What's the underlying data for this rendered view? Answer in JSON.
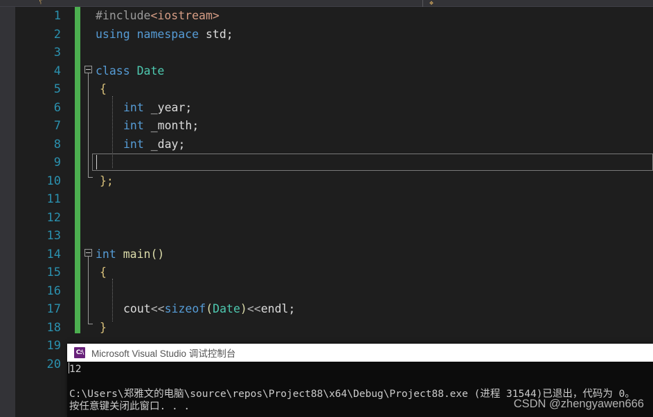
{
  "app": {
    "name": "Microsoft Visual Studio",
    "theme": "dark"
  },
  "toolbar": {
    "left_glyph": "⸮",
    "right_glyph": "❖"
  },
  "editor": {
    "language": "cpp",
    "line_numbers": [
      "1",
      "2",
      "3",
      "4",
      "5",
      "6",
      "7",
      "8",
      "9",
      "10",
      "11",
      "12",
      "13",
      "14",
      "15",
      "16",
      "17",
      "18",
      "19",
      "20"
    ],
    "current_line": "9",
    "lines": [
      {
        "n": "1",
        "text": "#include<iostream>"
      },
      {
        "n": "2",
        "text": "using namespace std;"
      },
      {
        "n": "3",
        "text": ""
      },
      {
        "n": "4",
        "text": "class Date"
      },
      {
        "n": "5",
        "text": "{"
      },
      {
        "n": "6",
        "text": "    int _year;"
      },
      {
        "n": "7",
        "text": "    int _month;"
      },
      {
        "n": "8",
        "text": "    int _day;"
      },
      {
        "n": "9",
        "text": ""
      },
      {
        "n": "10",
        "text": "};"
      },
      {
        "n": "11",
        "text": ""
      },
      {
        "n": "12",
        "text": ""
      },
      {
        "n": "13",
        "text": ""
      },
      {
        "n": "14",
        "text": "int main()"
      },
      {
        "n": "15",
        "text": "{"
      },
      {
        "n": "16",
        "text": ""
      },
      {
        "n": "17",
        "text": "    cout<<sizeof(Date)<<endl;"
      },
      {
        "n": "18",
        "text": "}"
      },
      {
        "n": "19",
        "text": ""
      },
      {
        "n": "20",
        "text": ""
      }
    ],
    "tokens": {
      "l1_include": "#include",
      "l1_header": "<iostream>",
      "l2_using": "using",
      "l2_namespace": "namespace",
      "l2_std": " std;",
      "l4_class": "class",
      "l4_name": "Date",
      "l5_brace": "{",
      "l6_type": "int",
      "l6_name": " _year;",
      "l7_type": "int",
      "l7_name": " _month;",
      "l8_type": "int",
      "l8_name": " _day;",
      "l10_brace": "};",
      "l14_type": "int",
      "l14_fn": "main",
      "l14_parens": "()",
      "l15_brace": "{",
      "l17_cout": "cout",
      "l17_op1": "<<",
      "l17_sizeof": "sizeof",
      "l17_lparen": "(",
      "l17_date": "Date",
      "l17_rparen": ")",
      "l17_op2": "<<",
      "l17_endl": "endl",
      "l17_semi": ";",
      "l18_brace": "}"
    },
    "colors": {
      "background": "#1e1e1e",
      "line_number": "#2b91af",
      "change_bar": "#4caf50",
      "keyword": "#569cd6",
      "type": "#4ec9b0",
      "function": "#dcdcaa",
      "string": "#d69d85",
      "plain": "#d4d4d4",
      "margin": "#333337"
    }
  },
  "console": {
    "title": "Microsoft Visual Studio 调试控制台",
    "icon": "cpp-console-icon",
    "output_value": "12",
    "exit_line": "C:\\Users\\郑雅文的电脑\\source\\repos\\Project88\\x64\\Debug\\Project88.exe (进程 31544)已退出，代码为 0。",
    "prompt_line": "按任意键关闭此窗口. . .",
    "background": "#0c0c0c",
    "foreground": "#cccccc"
  },
  "watermark": {
    "text": "CSDN @zhengyawen666"
  }
}
